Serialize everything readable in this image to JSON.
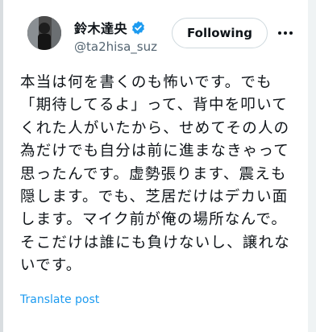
{
  "author": {
    "display_name": "鈴木達央",
    "handle": "@ta2hisa_suz",
    "verified": true
  },
  "follow_button": {
    "label": "Following"
  },
  "more_button": {
    "label": "···",
    "icon": "more-horizontal-icon"
  },
  "tweet": {
    "text": "本当は何を書くのも怖いです。でも「期待してるよ」って、背中を叩いてくれた人がいたから、せめてその人の為だけでも自分は前に進まなきゃって思ったんです。虚勢張ります、震えも隠します。でも、芝居だけはデカい面します。マイク前が俺の場所なんで。そこだけは誰にも負けないし、譲れないです。"
  },
  "translate_link": {
    "label": "Translate post"
  },
  "colors": {
    "accent": "#1d9bf0",
    "text": "#0f1419",
    "secondary": "#536471"
  }
}
